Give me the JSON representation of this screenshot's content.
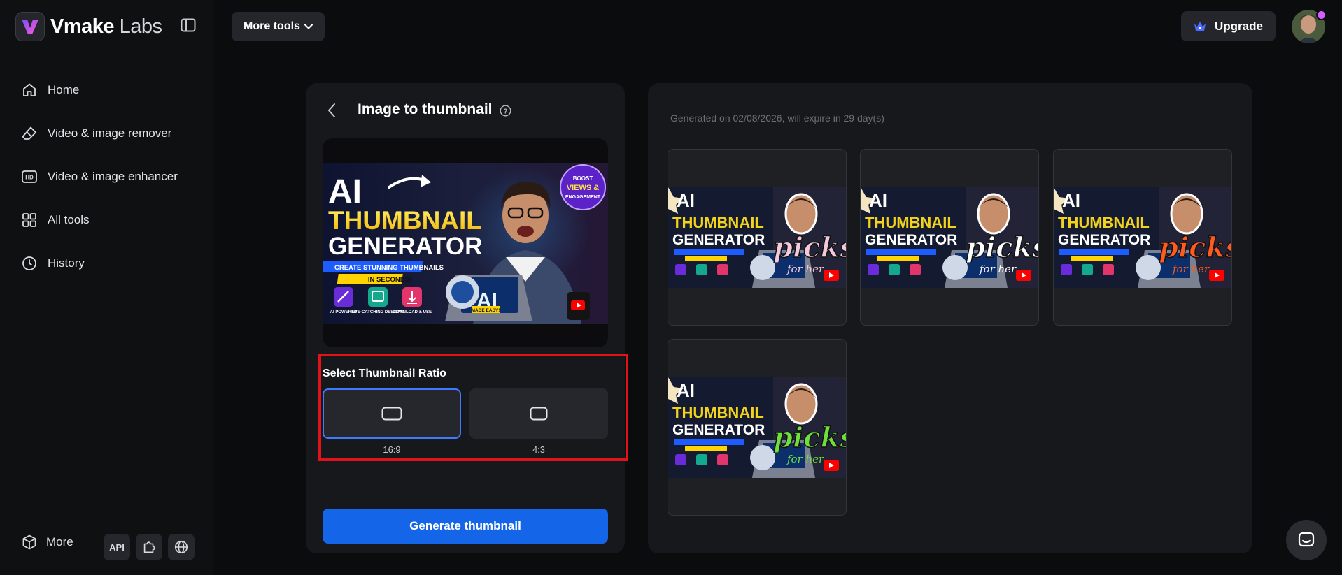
{
  "brand": {
    "name": "Vmake",
    "suffix": "Labs"
  },
  "sidebar": {
    "items": [
      {
        "label": "Home",
        "icon": "home-icon"
      },
      {
        "label": "Video & image remover",
        "icon": "eraser-icon"
      },
      {
        "label": "Video & image enhancer",
        "icon": "hd-icon"
      },
      {
        "label": "All tools",
        "icon": "grid-icon"
      },
      {
        "label": "History",
        "icon": "clock-icon"
      }
    ],
    "more_label": "More",
    "api_label": "API"
  },
  "topbar": {
    "more_tools_label": "More tools",
    "upgrade_label": "Upgrade"
  },
  "tool": {
    "title": "Image to thumbnail",
    "preview_text": {
      "line1": "AI",
      "line2": "THUMBNAIL",
      "line3": "GENERATOR",
      "banner": "CREATE STUNNING THUMBNAILS",
      "subbanner": "IN SECONDS!",
      "badge": "BOOST VIEWS & ENGAGEMENT",
      "ai_screen": "AI",
      "ai_screen_sub": "MADE EASY!",
      "features": [
        "AI POWERED",
        "EYE-CATCHING DESIGNS",
        "DOWNLOAD & USE"
      ]
    },
    "ratio_section_label": "Select Thumbnail Ratio",
    "ratios": [
      {
        "label": "16:9",
        "selected": true
      },
      {
        "label": "4:3",
        "selected": false
      }
    ],
    "generate_label": "Generate thumbnail"
  },
  "results": {
    "info": "Generated on 02/08/2026, will expire in 29 day(s)",
    "thumbnail_text": "picks",
    "thumbnail_sub": "for her",
    "items": [
      {
        "accent": "#f4c9dc"
      },
      {
        "accent": "#ffffff"
      },
      {
        "accent": "#ff5a1f"
      },
      {
        "accent": "#6ee03a"
      }
    ]
  },
  "colors": {
    "primary": "#1565e8",
    "highlight": "#e0131a",
    "selected_border": "#3f7bff"
  }
}
